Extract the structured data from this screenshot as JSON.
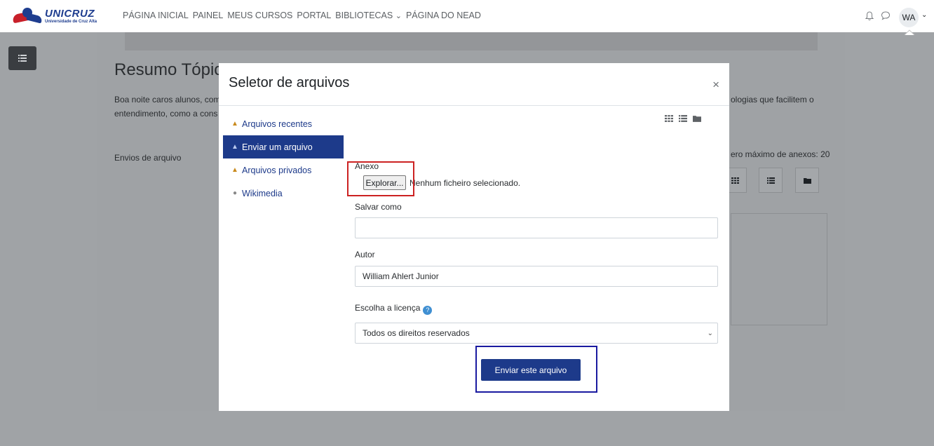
{
  "brand": {
    "name": "UNICRUZ",
    "subtitle": "Universidade de Cruz Alta"
  },
  "nav": {
    "links": [
      "PÁGINA INICIAL",
      "PAINEL",
      "MEUS CURSOS",
      "PORTAL",
      "BIBLIOTECAS",
      "PÁGINA DO NEAD"
    ],
    "libraries_caret": "⌄",
    "user_initials": "WA",
    "user_caret": "⌄"
  },
  "background": {
    "heading": "Resumo Tópico",
    "paragraph_line1": "Boa noite caros alunos, com",
    "paragraph_line1_right": "ologias que facilitem o",
    "paragraph_line2": "entendimento, como a cons",
    "envios": "Envios de arquivo",
    "max_attachments": "ero máximo de anexos: 20"
  },
  "modal": {
    "title": "Seletor de arquivos",
    "close": "×",
    "repositories": [
      {
        "label": "Arquivos recentes",
        "icon": "recent-files-icon",
        "active": false
      },
      {
        "label": "Enviar um arquivo",
        "icon": "upload-icon",
        "active": true
      },
      {
        "label": "Arquivos privados",
        "icon": "private-files-icon",
        "active": false
      },
      {
        "label": "Wikimedia",
        "icon": "wikimedia-icon",
        "active": false
      }
    ],
    "attachment": {
      "label": "Anexo",
      "browse_button": "Explorar...",
      "no_file": "Nenhum ficheiro selecionado."
    },
    "save_as": {
      "label": "Salvar como",
      "value": ""
    },
    "author": {
      "label": "Autor",
      "value": "William Ahlert Junior"
    },
    "license": {
      "label": "Escolha a licença",
      "selected": "Todos os direitos reservados"
    },
    "submit_button": "Enviar este arquivo"
  },
  "colors": {
    "primary": "#1d3a8a",
    "highlight_red": "#cc2222",
    "highlight_blue": "#1a1aa0",
    "backdrop": "#a0a3a6"
  }
}
